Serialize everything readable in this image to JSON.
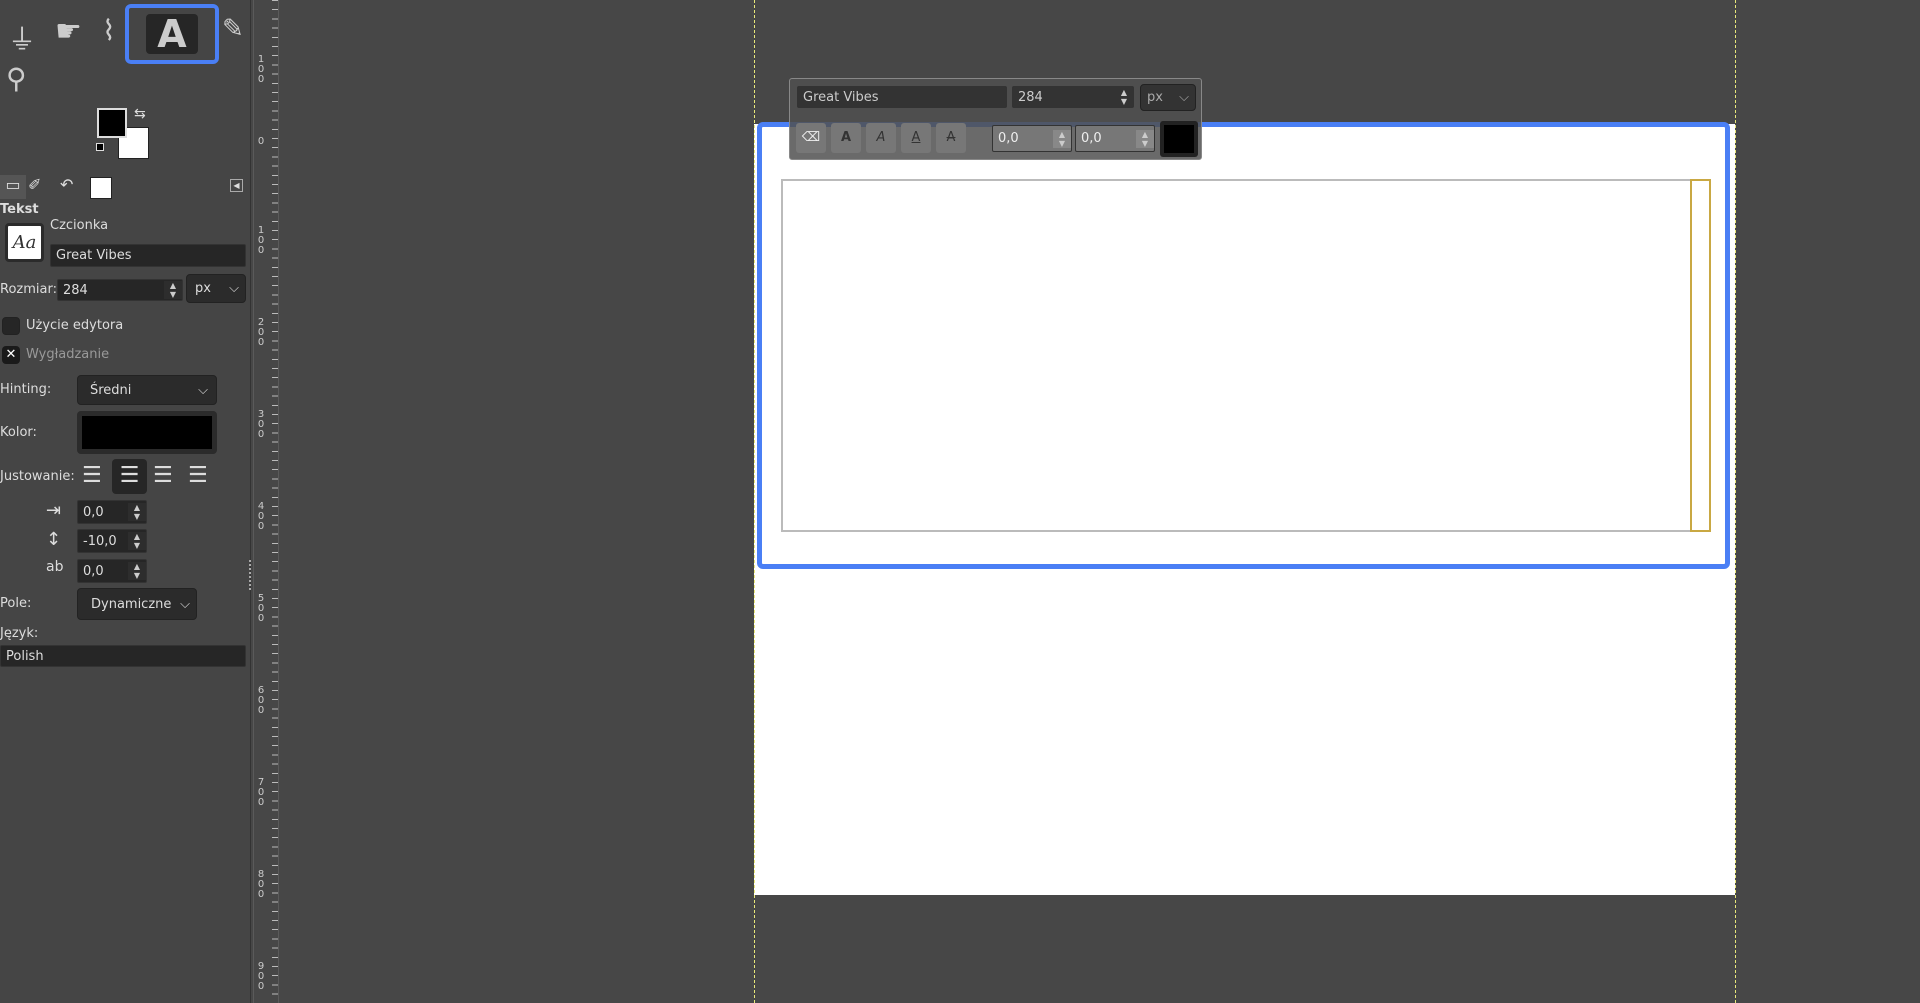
{
  "toolbox": {
    "active_tool": "text-tool",
    "fg_color": "#000000",
    "bg_color": "#ffffff",
    "accent": "#4a7ff5"
  },
  "options": {
    "title": "Tekst",
    "font_label": "Czcionka",
    "font_value": "Great Vibes",
    "font_preview": "Aa",
    "size_label": "Rozmiar:",
    "size_value": "284",
    "size_unit": "px",
    "use_editor_label": "Użycie edytora",
    "use_editor_checked": false,
    "antialias_label": "Wygładzanie",
    "antialias_checked": true,
    "hinting_label": "Hinting:",
    "hinting_value": "Średni",
    "color_label": "Kolor:",
    "color_value": "#000000",
    "justify_label": "Justowanie:",
    "justify_selected": "right",
    "indent_value": "0,0",
    "line_spacing_value": "-10,0",
    "letter_spacing_value": "0,0",
    "box_label": "Pole:",
    "box_value": "Dynamiczne",
    "language_label": "Język:",
    "language_value": "Polish"
  },
  "ruler": {
    "labels": [
      "100",
      "0",
      "100",
      "200",
      "300",
      "400",
      "500",
      "600",
      "700",
      "800",
      "900"
    ]
  },
  "text_toolbar": {
    "font": "Great Vibes",
    "size": "284",
    "unit": "px",
    "baseline": "0,0",
    "kerning": "0,0",
    "color": "#000000"
  }
}
